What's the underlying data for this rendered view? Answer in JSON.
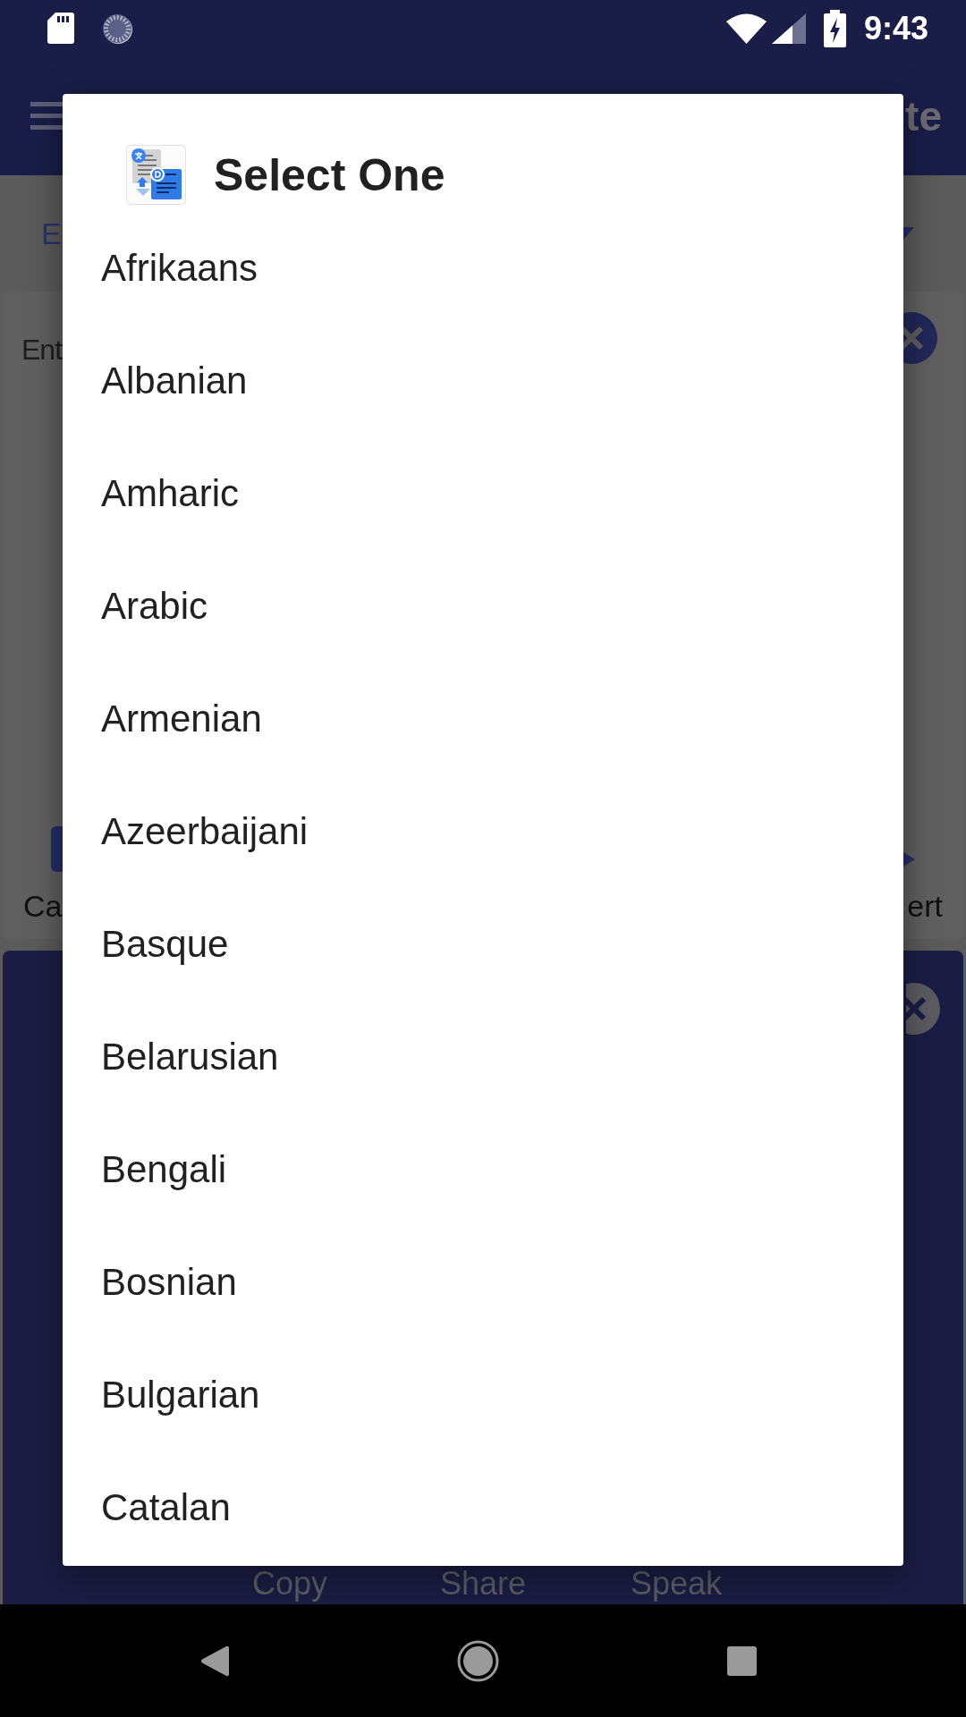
{
  "status_bar": {
    "time": "9:43"
  },
  "app_bar": {
    "title": "te"
  },
  "language_spinner": {
    "label": "E"
  },
  "input_card": {
    "text": "Ent",
    "buttons": [
      {
        "label": "Ca"
      },
      {
        "label": "ert"
      }
    ]
  },
  "output_card": {
    "buttons": [
      {
        "label": "Copy"
      },
      {
        "label": "Share"
      },
      {
        "label": "Speak"
      }
    ]
  },
  "dialog": {
    "title": "Select One",
    "items": [
      {
        "label": "Afrikaans",
        "selected": false
      },
      {
        "label": "Albanian",
        "selected": false
      },
      {
        "label": "Amharic",
        "selected": false
      },
      {
        "label": "Arabic",
        "selected": false
      },
      {
        "label": "Armenian",
        "selected": false
      },
      {
        "label": "Azeerbaijani",
        "selected": false
      },
      {
        "label": "Basque",
        "selected": false
      },
      {
        "label": "Belarusian",
        "selected": false
      },
      {
        "label": "Bengali",
        "selected": false
      },
      {
        "label": "Bosnian",
        "selected": false
      },
      {
        "label": "Bulgarian",
        "selected": false
      },
      {
        "label": "Catalan",
        "selected": false
      }
    ]
  }
}
